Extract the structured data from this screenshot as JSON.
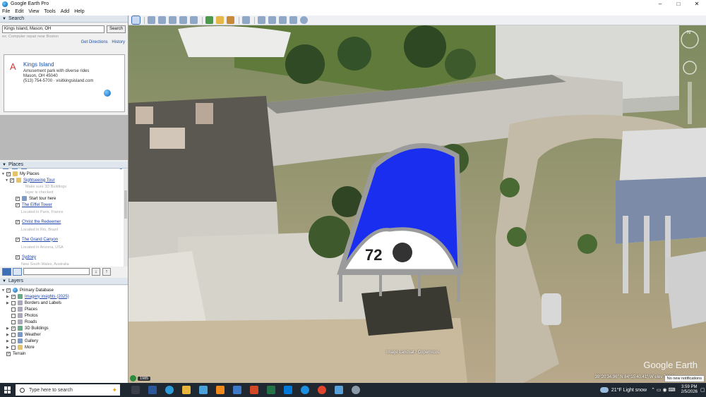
{
  "window": {
    "title": "Google Earth Pro",
    "minimize": "–",
    "maximize": "□",
    "close": "✕"
  },
  "menu": [
    "File",
    "Edit",
    "View",
    "Tools",
    "Add",
    "Help"
  ],
  "search": {
    "header": "Search",
    "value": "Kings Island, Mason, OH",
    "button": "Search",
    "hint": "ex: Computer repair near Boston",
    "get_directions": "Get Directions",
    "history": "History",
    "result": {
      "marker": "A",
      "title": "Kings Island",
      "line1": "Amusement park with diverse rides",
      "line2": "Mason, OH 45040",
      "line3": "(513) 754-5700 · visitkingsisland.com"
    }
  },
  "places": {
    "header": "Places",
    "my_places": "My Places",
    "tour": "Sightseeing Tour",
    "tour_note1": "Make sure 3D Buildings",
    "tour_note2": "layer is checked",
    "start_tour": "Start tour here",
    "items": [
      {
        "name": "The Eiffel Tower",
        "loc": "Located in Paris, France"
      },
      {
        "name": "Christ the Redeemer",
        "loc": "Located in Rio, Brazil"
      },
      {
        "name": "The Grand Canyon",
        "loc": "Located in Arizona, USA"
      },
      {
        "name": "Sydney",
        "loc": "New South Wales, Australia"
      }
    ]
  },
  "layers": {
    "header": "Layers",
    "primary": "Primary Database",
    "items": [
      {
        "label": "Imagery insights (2025)",
        "checked": true,
        "link": true
      },
      {
        "label": "Borders and Labels",
        "checked": false
      },
      {
        "label": "Places",
        "checked": false
      },
      {
        "label": "Photos",
        "checked": false
      },
      {
        "label": "Roads",
        "checked": false
      },
      {
        "label": "3D Buildings",
        "checked": true
      },
      {
        "label": "Weather",
        "checked": false
      },
      {
        "label": "Gallery",
        "checked": false
      },
      {
        "label": "More",
        "checked": false
      },
      {
        "label": "Terrain",
        "checked": true
      }
    ]
  },
  "map": {
    "bubble_number": "72",
    "credit": "Image Landsat / Copernicus",
    "watermark": "Google Earth",
    "status": "39°20'34.96\" N  84°15'40.41\" W  elev  744 ft",
    "year": "1985",
    "colors": {
      "blue_roof": "#1a2ef0",
      "outline": "#9b9b9b"
    }
  },
  "taskbar": {
    "search_placeholder": "Type here to search",
    "weather": "21°F  Light snow",
    "time": "3:59 PM",
    "date": "2/5/2026",
    "notification": "No new notifications"
  }
}
